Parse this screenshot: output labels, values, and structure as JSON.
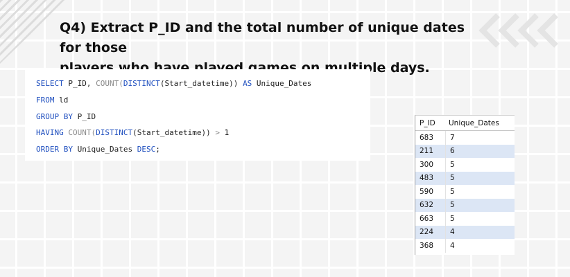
{
  "question": {
    "line1": "Q4) Extract P_ID and the total number of unique dates for those",
    "line2": "players who have played games on multiple days."
  },
  "decorations": {
    "top_left": "diagonal-stripes",
    "top_right": "chevrons-left-icon",
    "chevron_color": "#e6e6e6"
  },
  "sql": {
    "l1": {
      "k1": "SELECT",
      "t1": " P_ID, ",
      "f1": "COUNT",
      "p1": "(",
      "k2": "DISTINCT",
      "p2": "(Start_datetime)) ",
      "k3": "AS",
      "t2": " Unique_Dates"
    },
    "l2": {
      "k1": "FROM",
      "t1": " ld"
    },
    "l3": {
      "k1": "GROUP BY",
      "t1": " P_ID"
    },
    "l4": {
      "k1": "HAVING",
      "t1": " ",
      "f1": "COUNT",
      "p1": "(",
      "k2": "DISTINCT",
      "t2": "(Start_datetime)) ",
      "o1": ">",
      "t3": " ",
      "n1": "1"
    },
    "l5": {
      "k1": "ORDER BY",
      "t1": " Unique_Dates ",
      "k2": "DESC",
      "t2": ";"
    }
  },
  "results": {
    "headers": [
      "P_ID",
      "Unique_Dates"
    ],
    "rows": [
      [
        "683",
        "7"
      ],
      [
        "211",
        "6"
      ],
      [
        "300",
        "5"
      ],
      [
        "483",
        "5"
      ],
      [
        "590",
        "5"
      ],
      [
        "632",
        "5"
      ],
      [
        "663",
        "5"
      ],
      [
        "224",
        "4"
      ],
      [
        "368",
        "4"
      ]
    ]
  },
  "colors": {
    "keyword": "#1f4fbf",
    "alt_row": "#dce6f5",
    "background": "#f4f4f4"
  }
}
